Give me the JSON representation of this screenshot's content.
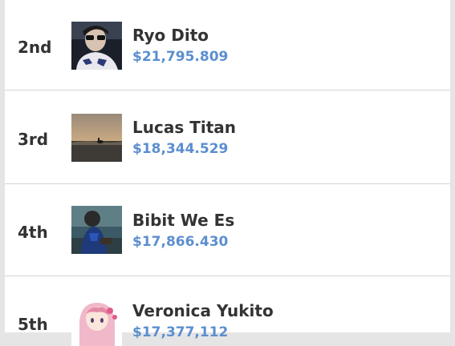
{
  "leaderboard": {
    "entries": [
      {
        "rank": "2nd",
        "name": "Ryo Dito",
        "amount": "$21,795.809",
        "avatar": "avatar-person-sunglasses"
      },
      {
        "rank": "3rd",
        "name": "Lucas Titan",
        "amount": "$18,344.529",
        "avatar": "avatar-sunset-sea"
      },
      {
        "rank": "4th",
        "name": "Bibit We Es",
        "amount": "$17,866.430",
        "avatar": "avatar-child-beach"
      },
      {
        "rank": "5th",
        "name": "Veronica Yukito",
        "amount": "$17,377,112",
        "avatar": "avatar-anime-girl"
      }
    ],
    "colors": {
      "amount": "#5b8fcf",
      "text": "#333333",
      "background": "#ffffff",
      "divider": "#d5d5d5"
    }
  }
}
